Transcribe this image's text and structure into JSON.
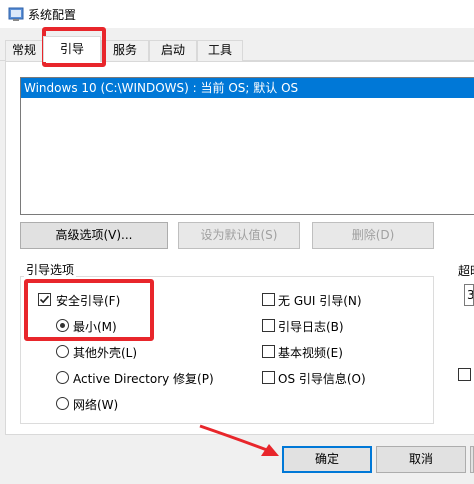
{
  "window": {
    "title": "系统配置",
    "icon": "msconfig-icon"
  },
  "tabs": [
    {
      "label": "常规"
    },
    {
      "label": "引导"
    },
    {
      "label": "服务"
    },
    {
      "label": "启动"
    },
    {
      "label": "工具"
    }
  ],
  "boot_list": {
    "items": [
      "Windows 10 (C:\\WINDOWS) : 当前 OS; 默认 OS"
    ],
    "selected_index": 0
  },
  "boot_buttons": {
    "advanced": "高级选项(V)...",
    "set_default": "设为默认值(S)",
    "delete": "删除(D)"
  },
  "boot_options": {
    "group_label": "引导选项",
    "safe_boot": {
      "label": "安全引导(F)",
      "checked": true
    },
    "minimal": {
      "label": "最小(M)",
      "selected": true
    },
    "alternate_shell": {
      "label": "其他外壳(L)"
    },
    "active_directory": {
      "label": "Active Directory 修复(P)"
    },
    "network": {
      "label": "网络(W)"
    },
    "no_gui": {
      "label": "无 GUI 引导(N)",
      "checked": false
    },
    "boot_log": {
      "label": "引导日志(B)",
      "checked": false
    },
    "base_video": {
      "label": "基本视频(E)",
      "checked": false
    },
    "os_boot_info": {
      "label": "OS 引导信息(O)",
      "checked": false
    }
  },
  "timeout": {
    "label": "超时",
    "value": "3"
  },
  "dialog_buttons": {
    "ok": "确定",
    "cancel": "取消"
  },
  "annotation_color": "#e8262b",
  "accent_color": "#0078d7"
}
